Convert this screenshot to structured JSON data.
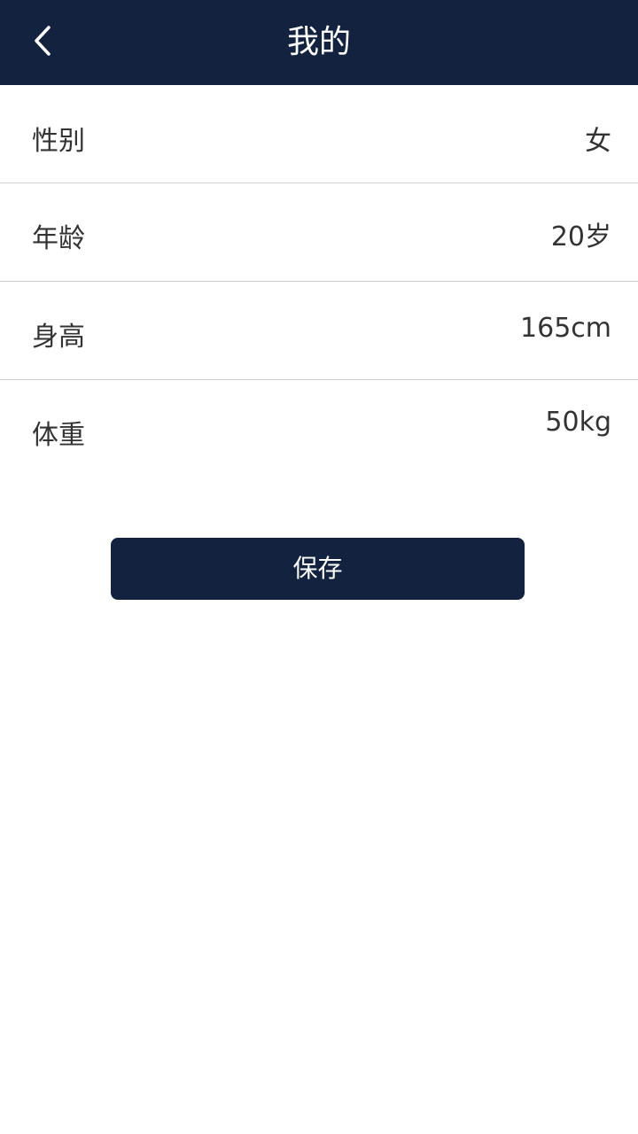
{
  "header": {
    "title": "我的",
    "back_icon": "chevron-left-icon",
    "background_color": "#13233f"
  },
  "profile": {
    "rows": [
      {
        "label": "性别",
        "value": "女"
      },
      {
        "label": "年龄",
        "value": "20岁"
      },
      {
        "label": "身高",
        "value": "165cm"
      },
      {
        "label": "体重",
        "value": "50kg"
      }
    ]
  },
  "actions": {
    "save_label": "保存"
  }
}
